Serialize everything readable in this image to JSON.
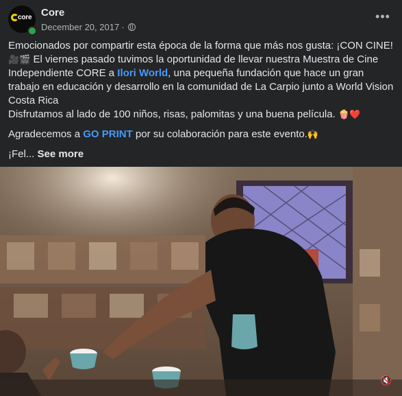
{
  "post": {
    "page_name": "Core",
    "date": "December 20, 2017",
    "separator": "·",
    "avatar_text": "core",
    "more_label": "•••",
    "text": {
      "line1": "Emocionados por compartir esta época de la forma que más nos gusta: ¡CON CINE! ",
      "line1_emoji": "🎥🎬",
      "line1b": " El viernes pasado tuvimos la oportunidad de llevar nuestra Muestra de Cine Independiente CORE a ",
      "link1": "Ilori World",
      "line1c": ", una pequeña fundación que hace un gran trabajo en educación y desarrollo en la comunidad de La Carpio junto a World Vision Costa Rica",
      "line2": "Disfrutamos al lado de 100 niños, risas, palomitas y una buena película. ",
      "line2_emoji": "🍿❤️",
      "line3a": "Agradecemos a ",
      "link2": "GO PRINT",
      "line3b": " por su colaboración para este evento.",
      "line3_emoji": "🙌",
      "truncated": "¡Fel... ",
      "see_more": "See more"
    }
  },
  "media": {
    "mute_label": "🔇"
  },
  "colors": {
    "background": "#242526",
    "text": "#e4e6eb",
    "secondary": "#b0b3b8",
    "link": "#4599ff",
    "online": "#31a24c",
    "brand_yellow": "#f2d200"
  }
}
